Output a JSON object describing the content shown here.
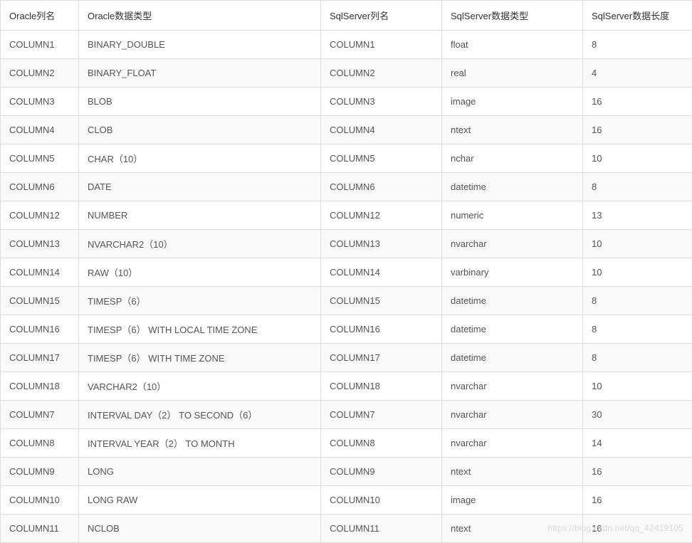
{
  "table": {
    "headers": {
      "oracle_col": "Oracle列名",
      "oracle_type": "Oracle数据类型",
      "sqlserver_col": "SqlServer列名",
      "sqlserver_type": "SqlServer数据类型",
      "sqlserver_len": "SqlServer数据长度"
    },
    "rows": [
      {
        "oracle_col": "COLUMN1",
        "oracle_type": "BINARY_DOUBLE",
        "sqlserver_col": "COLUMN1",
        "sqlserver_type": "float",
        "sqlserver_len": "8"
      },
      {
        "oracle_col": "COLUMN2",
        "oracle_type": "BINARY_FLOAT",
        "sqlserver_col": "COLUMN2",
        "sqlserver_type": "real",
        "sqlserver_len": "4"
      },
      {
        "oracle_col": "COLUMN3",
        "oracle_type": "BLOB",
        "sqlserver_col": "COLUMN3",
        "sqlserver_type": "image",
        "sqlserver_len": "16"
      },
      {
        "oracle_col": "COLUMN4",
        "oracle_type": "CLOB",
        "sqlserver_col": "COLUMN4",
        "sqlserver_type": "ntext",
        "sqlserver_len": "16"
      },
      {
        "oracle_col": "COLUMN5",
        "oracle_type": "CHAR（10）",
        "sqlserver_col": "COLUMN5",
        "sqlserver_type": "nchar",
        "sqlserver_len": "10"
      },
      {
        "oracle_col": "COLUMN6",
        "oracle_type": "DATE",
        "sqlserver_col": "COLUMN6",
        "sqlserver_type": "datetime",
        "sqlserver_len": "8"
      },
      {
        "oracle_col": "COLUMN12",
        "oracle_type": "NUMBER",
        "sqlserver_col": "COLUMN12",
        "sqlserver_type": "numeric",
        "sqlserver_len": "13"
      },
      {
        "oracle_col": "COLUMN13",
        "oracle_type": "NVARCHAR2（10）",
        "sqlserver_col": "COLUMN13",
        "sqlserver_type": "nvarchar",
        "sqlserver_len": "10"
      },
      {
        "oracle_col": "COLUMN14",
        "oracle_type": "RAW（10）",
        "sqlserver_col": "COLUMN14",
        "sqlserver_type": "varbinary",
        "sqlserver_len": "10"
      },
      {
        "oracle_col": "COLUMN15",
        "oracle_type": "TIMESP（6）",
        "sqlserver_col": "COLUMN15",
        "sqlserver_type": "datetime",
        "sqlserver_len": "8"
      },
      {
        "oracle_col": "COLUMN16",
        "oracle_type": "TIMESP（6） WITH LOCAL TIME ZONE",
        "sqlserver_col": "COLUMN16",
        "sqlserver_type": "datetime",
        "sqlserver_len": "8"
      },
      {
        "oracle_col": "COLUMN17",
        "oracle_type": "TIMESP（6） WITH TIME ZONE",
        "sqlserver_col": "COLUMN17",
        "sqlserver_type": "datetime",
        "sqlserver_len": "8"
      },
      {
        "oracle_col": "COLUMN18",
        "oracle_type": "VARCHAR2（10）",
        "sqlserver_col": "COLUMN18",
        "sqlserver_type": "nvarchar",
        "sqlserver_len": "10"
      },
      {
        "oracle_col": "COLUMN7",
        "oracle_type": "INTERVAL DAY（2） TO SECOND（6）",
        "sqlserver_col": "COLUMN7",
        "sqlserver_type": "nvarchar",
        "sqlserver_len": "30"
      },
      {
        "oracle_col": "COLUMN8",
        "oracle_type": "INTERVAL YEAR（2） TO MONTH",
        "sqlserver_col": "COLUMN8",
        "sqlserver_type": "nvarchar",
        "sqlserver_len": "14"
      },
      {
        "oracle_col": "COLUMN9",
        "oracle_type": "LONG",
        "sqlserver_col": "COLUMN9",
        "sqlserver_type": "ntext",
        "sqlserver_len": "16"
      },
      {
        "oracle_col": "COLUMN10",
        "oracle_type": "LONG RAW",
        "sqlserver_col": "COLUMN10",
        "sqlserver_type": "image",
        "sqlserver_len": "16"
      },
      {
        "oracle_col": "COLUMN11",
        "oracle_type": "NCLOB",
        "sqlserver_col": "COLUMN11",
        "sqlserver_type": "ntext",
        "sqlserver_len": "16"
      }
    ]
  },
  "watermark": "https://blog.csdn.net/qq_42419105"
}
